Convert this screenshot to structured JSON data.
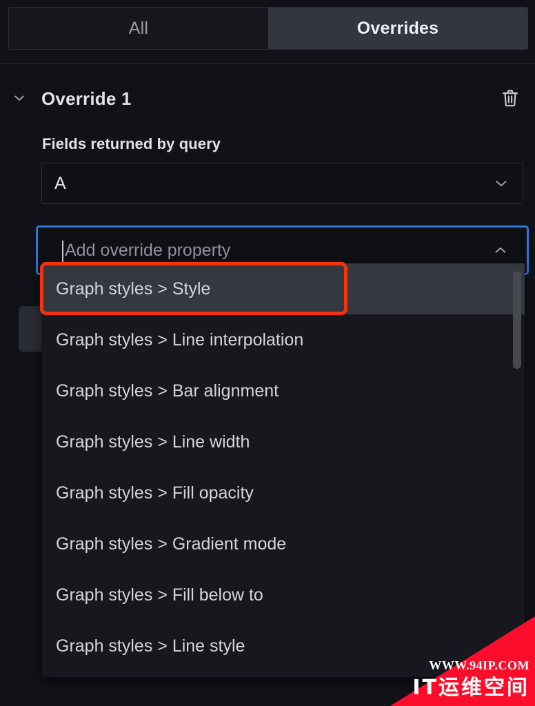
{
  "tabs": [
    {
      "label": "All",
      "active": false
    },
    {
      "label": "Overrides",
      "active": true
    }
  ],
  "override": {
    "title": "Override 1",
    "collapse_icon": "chevron-down-icon",
    "delete_icon": "trash-icon",
    "field_label": "Fields returned by query",
    "query_select": {
      "value": "A",
      "caret_icon": "chevron-down-icon"
    },
    "add_property": {
      "placeholder": "Add override property",
      "value": "",
      "arrow_icon": "chevron-up-icon",
      "focus_color": "#3274d9"
    }
  },
  "dropdown": {
    "items": [
      {
        "label": "Graph styles > Style",
        "highlighted": true
      },
      {
        "label": "Graph styles > Line interpolation",
        "highlighted": false
      },
      {
        "label": "Graph styles > Bar alignment",
        "highlighted": false
      },
      {
        "label": "Graph styles > Line width",
        "highlighted": false
      },
      {
        "label": "Graph styles > Fill opacity",
        "highlighted": false
      },
      {
        "label": "Graph styles > Gradient mode",
        "highlighted": false
      },
      {
        "label": "Graph styles > Fill below to",
        "highlighted": false
      },
      {
        "label": "Graph styles > Line style",
        "highlighted": false
      }
    ],
    "scrollbar": true
  },
  "annotation": {
    "color": "#f5320d",
    "target": "Graph styles > Style"
  },
  "watermark": {
    "url": "WWW.94IP.COM",
    "brand": "IT运维空间",
    "color": "#fc0d2b"
  }
}
